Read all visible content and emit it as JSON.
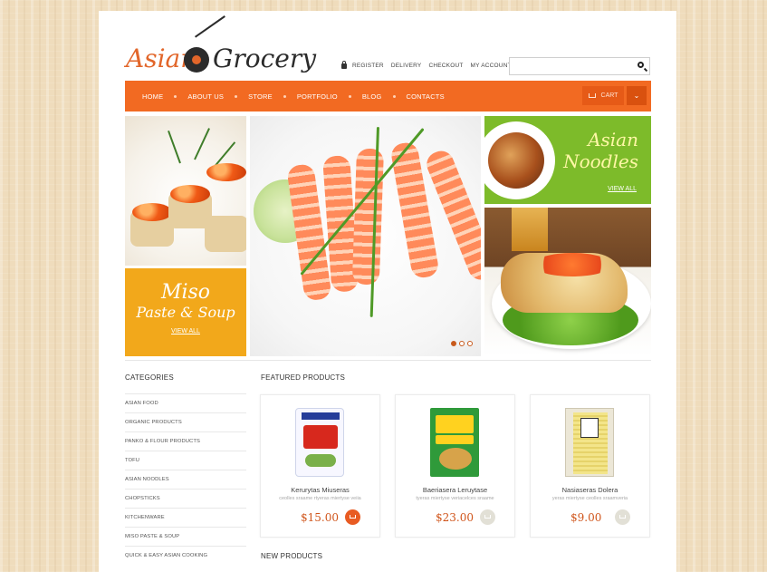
{
  "logo": {
    "word1": "Asian",
    "word2": "Grocery"
  },
  "toplinks": [
    "REGISTER",
    "DELIVERY",
    "CHECKOUT",
    "MY ACCOUNT"
  ],
  "search": {
    "placeholder": ""
  },
  "nav": {
    "items": [
      "HOME",
      "ABOUT US",
      "STORE",
      "PORTFOLIO",
      "BLOG",
      "CONTACTS"
    ],
    "cart_label": "CART"
  },
  "banners": {
    "noodles": {
      "line1": "Asian",
      "line2": "Noodles",
      "link": "VIEW ALL"
    },
    "miso": {
      "line1": "Miso",
      "line2": "Paste & Soup",
      "link": "VIEW ALL"
    }
  },
  "categories": {
    "title": "CATEGORIES",
    "items": [
      "ASIAN FOOD",
      "ORGANIC PRODUCTS",
      "PANKO & FLOUR PRODUCTS",
      "TOFU",
      "ASIAN NOODLES",
      "CHOPSTICKS",
      "KITCHENWARE",
      "MISO PASTE & SOUP",
      "QUICK & EASY ASIAN COOKING"
    ]
  },
  "featured": {
    "title": "FEATURED PRODUCTS",
    "products": [
      {
        "name": "Kerurytas Miuseras",
        "desc": "ceolles sraame rtyeras miertyse veiia",
        "price": "$15.00"
      },
      {
        "name": "Baeriasera Leruytase",
        "desc": "tyeras miertyse veriacelces sraame",
        "price": "$23.00"
      },
      {
        "name": "Nasiaseras Dolera",
        "desc": "yeras miertyse ceolles sraamveria",
        "price": "$9.00"
      }
    ]
  },
  "new_products": {
    "title": "NEW PRODUCTS"
  },
  "colors": {
    "accent": "#f26a22",
    "green": "#7dbb2a",
    "yellow": "#f2a81b"
  }
}
